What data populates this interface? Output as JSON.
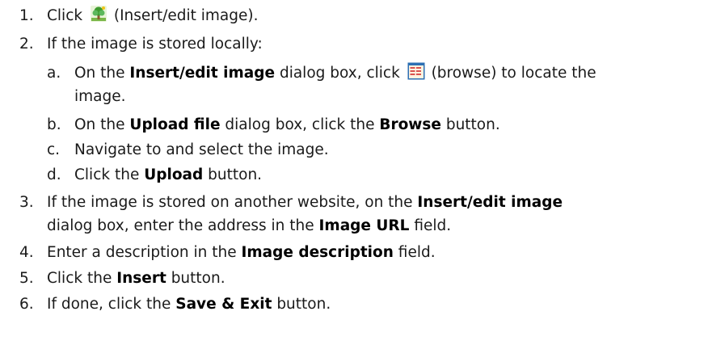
{
  "steps": [
    {
      "num": "1.",
      "pre": "Click ",
      "icon": "insert-image-icon",
      "post": " (Insert/edit image)."
    },
    {
      "num": "2.",
      "text": "If the image is stored locally:",
      "substeps": [
        {
          "num": "a.",
          "t1": "On the ",
          "b1": "Insert/edit image",
          "t2": " dialog box, click ",
          "icon": "browse-icon",
          "t3": " (browse) to locate the",
          "line2": "image."
        },
        {
          "num": "b.",
          "t1": "On the ",
          "b1": "Upload file",
          "t2": " dialog box, click the ",
          "b2": "Browse",
          "t3": " button."
        },
        {
          "num": "c.",
          "t1": "Navigate to and select the image."
        },
        {
          "num": "d.",
          "t1": "Click the ",
          "b1": "Upload",
          "t2": " button."
        }
      ]
    },
    {
      "num": "3.",
      "t1": "If the image is stored on another website, on the ",
      "b1": "Insert/edit image",
      "line2_t1": "dialog box, enter the address in the ",
      "line2_b1": "Image URL",
      "line2_t2": " field."
    },
    {
      "num": "4.",
      "t1": "Enter a description in the ",
      "b1": "Image description",
      "t2": " field."
    },
    {
      "num": "5.",
      "t1": "Click the ",
      "b1": "Insert",
      "t2": " button."
    },
    {
      "num": "6.",
      "t1": "If done, click the ",
      "b1": "Save & Exit",
      "t2": " button."
    }
  ]
}
